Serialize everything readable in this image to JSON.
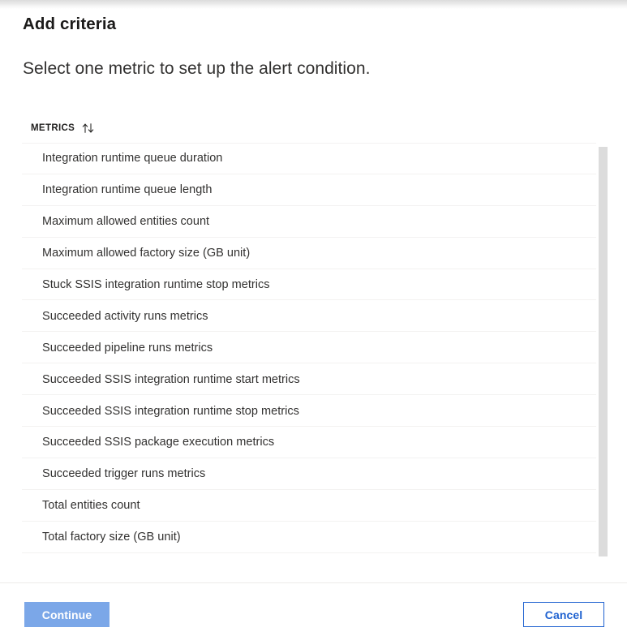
{
  "header": {
    "title": "Add criteria",
    "subtitle": "Select one metric to set up the alert condition."
  },
  "list": {
    "column_header": "METRICS",
    "sort_icon": "sort-ascending-descending-icon",
    "items": [
      {
        "label": "Integration runtime queue duration"
      },
      {
        "label": "Integration runtime queue length"
      },
      {
        "label": "Maximum allowed entities count"
      },
      {
        "label": "Maximum allowed factory size (GB unit)"
      },
      {
        "label": "Stuck SSIS integration runtime stop metrics"
      },
      {
        "label": "Succeeded activity runs metrics"
      },
      {
        "label": "Succeeded pipeline runs metrics"
      },
      {
        "label": "Succeeded SSIS integration runtime start metrics"
      },
      {
        "label": "Succeeded SSIS integration runtime stop metrics"
      },
      {
        "label": "Succeeded SSIS package execution metrics"
      },
      {
        "label": "Succeeded trigger runs metrics"
      },
      {
        "label": "Total entities count"
      },
      {
        "label": "Total factory size (GB unit)"
      }
    ]
  },
  "footer": {
    "continue_label": "Continue",
    "cancel_label": "Cancel"
  },
  "colors": {
    "primary_button_disabled": "#7ba7e8",
    "secondary_button_border": "#1f62d0",
    "secondary_button_text": "#1f62d0",
    "row_divider": "#f3f2f1",
    "scrollbar_thumb": "#dcdcdc",
    "title_text": "#1b1a19",
    "body_text": "#323130"
  }
}
